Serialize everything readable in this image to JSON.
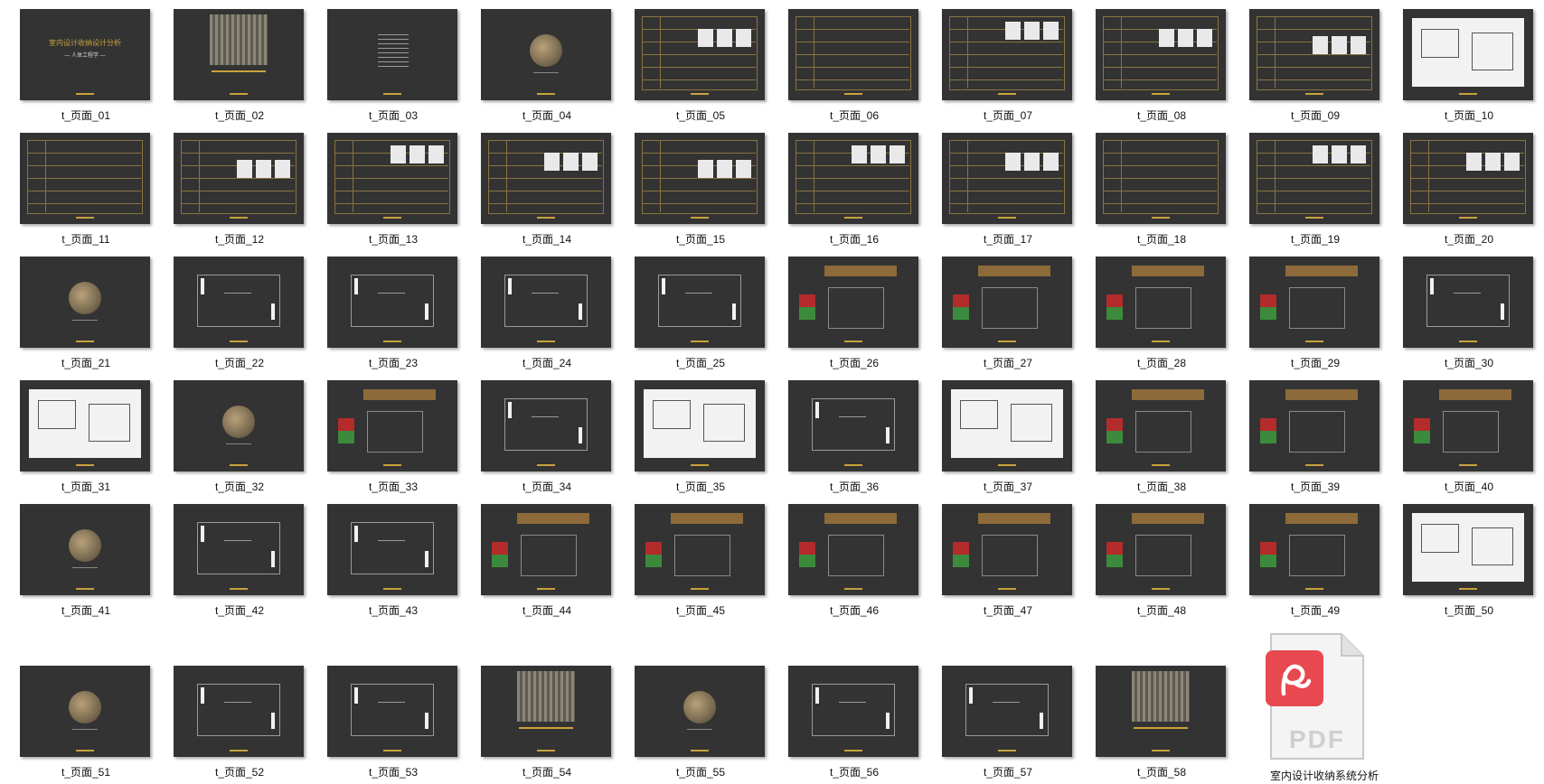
{
  "files": [
    {
      "name": "t_页面_01",
      "kind": "title"
    },
    {
      "name": "t_页面_02",
      "kind": "photo"
    },
    {
      "name": "t_页面_03",
      "kind": "text"
    },
    {
      "name": "t_页面_04",
      "kind": "circle"
    },
    {
      "name": "t_页面_05",
      "kind": "table-img"
    },
    {
      "name": "t_页面_06",
      "kind": "table"
    },
    {
      "name": "t_页面_07",
      "kind": "table-img"
    },
    {
      "name": "t_页面_08",
      "kind": "table-img"
    },
    {
      "name": "t_页面_09",
      "kind": "table-img"
    },
    {
      "name": "t_页面_10",
      "kind": "sketch"
    },
    {
      "name": "t_页面_11",
      "kind": "table"
    },
    {
      "name": "t_页面_12",
      "kind": "table-img"
    },
    {
      "name": "t_页面_13",
      "kind": "table-img"
    },
    {
      "name": "t_页面_14",
      "kind": "table-img"
    },
    {
      "name": "t_页面_15",
      "kind": "table-img"
    },
    {
      "name": "t_页面_16",
      "kind": "table-img"
    },
    {
      "name": "t_页面_17",
      "kind": "table-img"
    },
    {
      "name": "t_页面_18",
      "kind": "table"
    },
    {
      "name": "t_页面_19",
      "kind": "table-img"
    },
    {
      "name": "t_页面_20",
      "kind": "table-img"
    },
    {
      "name": "t_页面_21",
      "kind": "circle"
    },
    {
      "name": "t_页面_22",
      "kind": "plan"
    },
    {
      "name": "t_页面_23",
      "kind": "plan"
    },
    {
      "name": "t_页面_24",
      "kind": "plan"
    },
    {
      "name": "t_页面_25",
      "kind": "plan"
    },
    {
      "name": "t_页面_26",
      "kind": "color-plan"
    },
    {
      "name": "t_页面_27",
      "kind": "color-plan"
    },
    {
      "name": "t_页面_28",
      "kind": "color-plan"
    },
    {
      "name": "t_页面_29",
      "kind": "color-plan"
    },
    {
      "name": "t_页面_30",
      "kind": "plan"
    },
    {
      "name": "t_页面_31",
      "kind": "sketch"
    },
    {
      "name": "t_页面_32",
      "kind": "circle"
    },
    {
      "name": "t_页面_33",
      "kind": "color-plan"
    },
    {
      "name": "t_页面_34",
      "kind": "plan"
    },
    {
      "name": "t_页面_35",
      "kind": "sketch"
    },
    {
      "name": "t_页面_36",
      "kind": "plan"
    },
    {
      "name": "t_页面_37",
      "kind": "sketch"
    },
    {
      "name": "t_页面_38",
      "kind": "color-plan"
    },
    {
      "name": "t_页面_39",
      "kind": "color-plan"
    },
    {
      "name": "t_页面_40",
      "kind": "color-plan"
    },
    {
      "name": "t_页面_41",
      "kind": "circle"
    },
    {
      "name": "t_页面_42",
      "kind": "plan"
    },
    {
      "name": "t_页面_43",
      "kind": "plan"
    },
    {
      "name": "t_页面_44",
      "kind": "color-plan"
    },
    {
      "name": "t_页面_45",
      "kind": "color-plan"
    },
    {
      "name": "t_页面_46",
      "kind": "color-plan"
    },
    {
      "name": "t_页面_47",
      "kind": "color-plan"
    },
    {
      "name": "t_页面_48",
      "kind": "color-plan"
    },
    {
      "name": "t_页面_49",
      "kind": "color-plan"
    },
    {
      "name": "t_页面_50",
      "kind": "sketch"
    },
    {
      "name": "t_页面_51",
      "kind": "circle"
    },
    {
      "name": "t_页面_52",
      "kind": "plan"
    },
    {
      "name": "t_页面_53",
      "kind": "plan"
    },
    {
      "name": "t_页面_54",
      "kind": "photo"
    },
    {
      "name": "t_页面_55",
      "kind": "circle"
    },
    {
      "name": "t_页面_56",
      "kind": "plan"
    },
    {
      "name": "t_页面_57",
      "kind": "plan"
    },
    {
      "name": "t_页面_58",
      "kind": "photo"
    }
  ],
  "slide01": {
    "title": "室内设计收纳设计分析",
    "subtitle": "— 人体工程学 —"
  },
  "pdf": {
    "label": "PDF",
    "name": "室内设计收纳系统分析",
    "icon": "pdf-file-icon"
  },
  "colors": {
    "background": "#ffffff",
    "slide": "#333333",
    "gold": "#c9a23b",
    "pdf_red": "#e8484f"
  }
}
